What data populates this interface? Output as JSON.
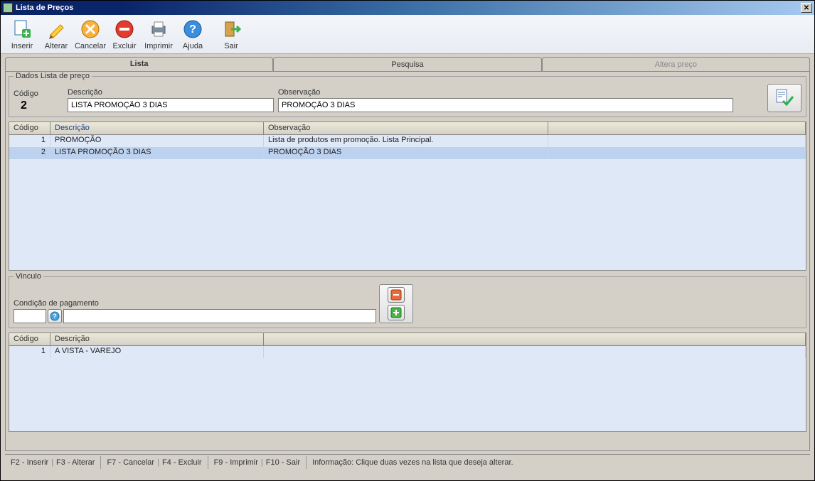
{
  "window": {
    "title": "Lista de Preços"
  },
  "toolbar": {
    "inserir": "Inserir",
    "alterar": "Alterar",
    "cancelar": "Cancelar",
    "excluir": "Excluir",
    "imprimir": "Imprimir",
    "ajuda": "Ajuda",
    "sair": "Sair"
  },
  "tabs": {
    "lista": "Lista",
    "pesquisa": "Pesquisa",
    "altera": "Altera preço"
  },
  "dados": {
    "legend": "Dados Lista de preço",
    "codigo_label": "Código",
    "codigo_value": "2",
    "descricao_label": "Descrição",
    "descricao_value": "LISTA PROMOÇÃO 3 DIAS",
    "observacao_label": "Observação",
    "observacao_value": "PROMOÇÃO 3 DIAS"
  },
  "grid1": {
    "col_codigo": "Código",
    "col_descricao": "Descrição",
    "col_observacao": "Observação",
    "rows": [
      {
        "codigo": "1",
        "descricao": "PROMOÇÃO",
        "observacao": "Lista de produtos em promoção. Lista Principal."
      },
      {
        "codigo": "2",
        "descricao": "LISTA PROMOÇÃO 3 DIAS",
        "observacao": "PROMOÇÃO 3 DIAS"
      }
    ]
  },
  "vinculo": {
    "legend": "Vinculo",
    "condicao_label": "Condição de pagamento",
    "codigo_value": "",
    "descricao_value": ""
  },
  "grid2": {
    "col_codigo": "Código",
    "col_descricao": "Descrição",
    "rows": [
      {
        "codigo": "1",
        "descricao": "A VISTA - VAREJO"
      }
    ]
  },
  "status": {
    "f2": "F2 - Inserir",
    "f3": "F3 - Alterar",
    "f7": "F7 - Cancelar",
    "f4": "F4 - Excluir",
    "f9": "F9 - Imprimir",
    "f10": "F10 - Sair",
    "info": "Informação: Clique duas vezes na lista que deseja alterar."
  }
}
